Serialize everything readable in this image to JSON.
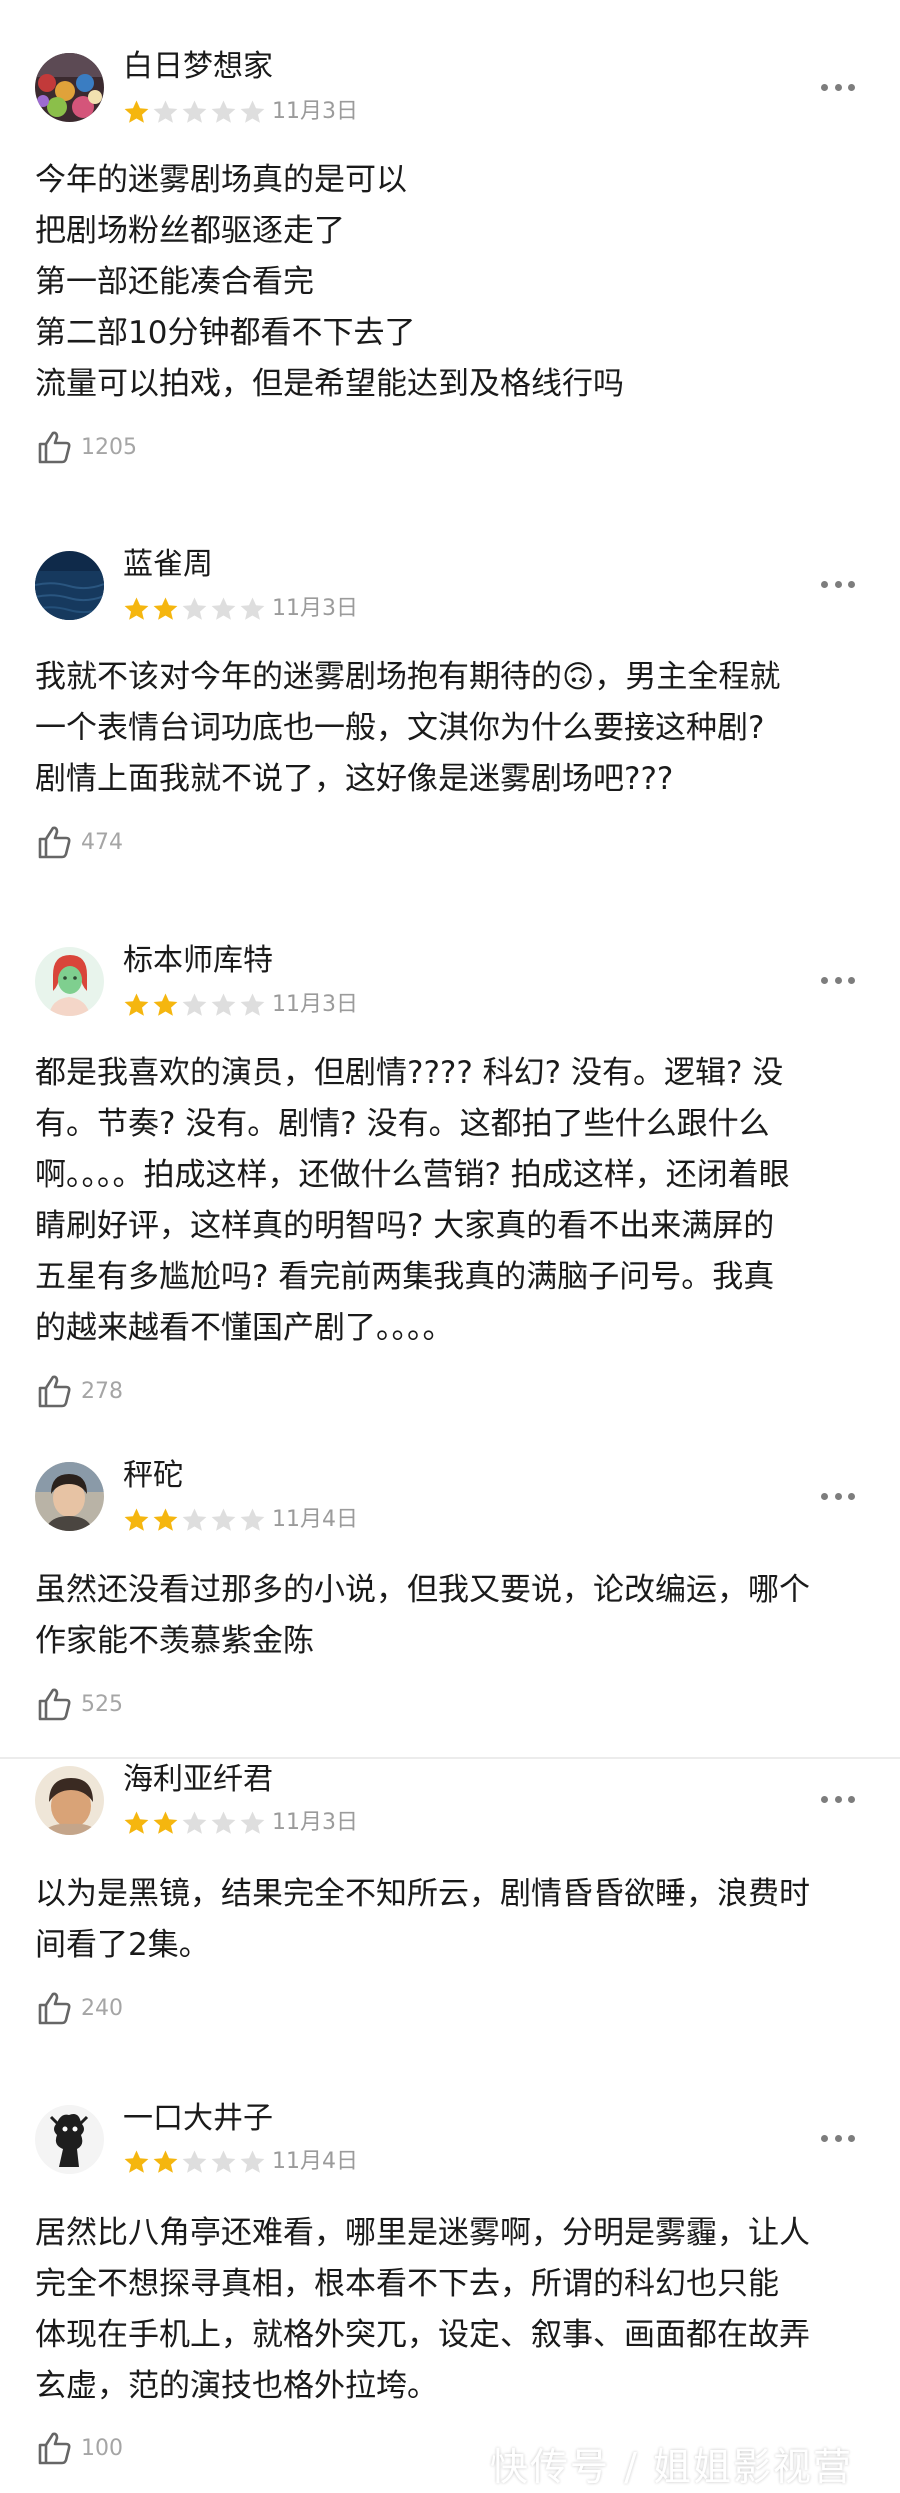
{
  "reviews": [
    {
      "username": "白日梦想家",
      "rating": 1,
      "date": "11月3日",
      "content": "今年的迷雾剧场真的是可以\n把剧场粉丝都驱逐走了\n第一部还能凑合看完\n第二部10分钟都看不下去了\n流量可以拍戏，但是希望能达到及格线行吗",
      "likes": "1205",
      "avatar": "avatar-colorful-crowd"
    },
    {
      "username": "蓝雀周",
      "rating": 2,
      "date": "11月3日",
      "content": "我就不该对今年的迷雾剧场抱有期待的🙃，男主全程就\n一个表情台词功底也一般，文淇你为什么要接这种剧?\n剧情上面我就不说了，这好像是迷雾剧场吧???",
      "likes": "474",
      "avatar": "avatar-dark-sea"
    },
    {
      "username": "标本师库特",
      "rating": 2,
      "date": "11月3日",
      "content": "都是我喜欢的演员，但剧情???? 科幻? 没有。逻辑? 没\n有。节奏? 没有。剧情? 没有。这都拍了些什么跟什么\n啊。。。。拍成这样，还做什么营销? 拍成这样，还闭着眼\n睛刷好评，这样真的明智吗? 大家真的看不出来满屏的\n五星有多尴尬吗? 看完前两集我真的满脑子问号。我真\n的越来越看不懂国产剧了。。。。",
      "likes": "278",
      "avatar": "avatar-illustrated-girl"
    },
    {
      "username": "秤砣",
      "rating": 2,
      "date": "11月4日",
      "content": "虽然还没看过那多的小说，但我又要说，论改编运，哪个\n作家能不羡慕紫金陈",
      "likes": "525",
      "avatar": "avatar-person-photo"
    },
    {
      "username": "海利亚纤君",
      "rating": 2,
      "date": "11月3日",
      "content": "以为是黑镜，结果完全不知所云，剧情昏昏欲睡，浪费时\n间看了2集。",
      "likes": "240",
      "avatar": "avatar-person-warm"
    },
    {
      "username": "一口大井子",
      "rating": 2,
      "date": "11月4日",
      "content": "居然比八角亭还难看，哪里是迷雾啊，分明是雾霾，让人\n完全不想探寻真相，根本看不下去，所谓的科幻也只能\n体现在手机上，就格外突兀，设定、叙事、画面都在故弄\n玄虚，范的演技也格外拉垮。",
      "likes": "100",
      "avatar": "avatar-ink-figure"
    }
  ],
  "watermark": "快传号 / 姐姐影视营",
  "colors": {
    "star_filled": "#f5b60f",
    "star_empty": "#dedede",
    "meta_gray": "#9b9b9b"
  }
}
